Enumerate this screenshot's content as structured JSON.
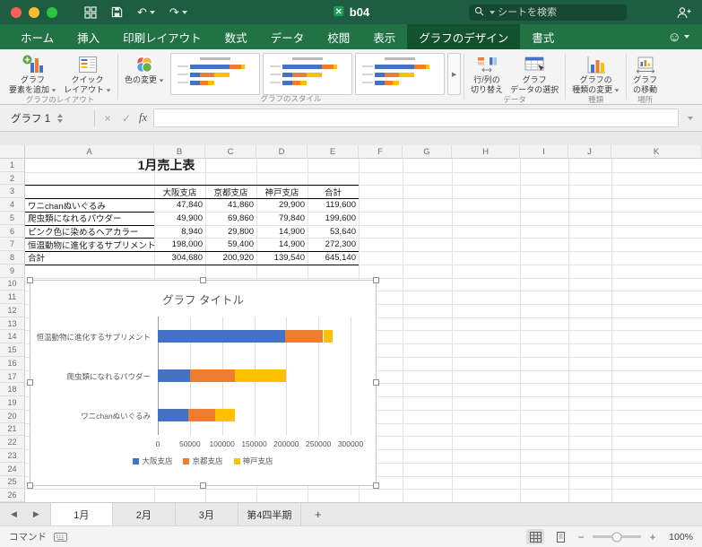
{
  "titlebar": {
    "title": "b04",
    "search_placeholder": "シートを検索"
  },
  "icons": {
    "undo": "↶",
    "redo": "↷",
    "smiley": "☺",
    "prev_sheet": "◀",
    "next_sheet": "▶",
    "gallery_more": "▶",
    "cancel": "×",
    "enter": "✓",
    "zoom_out": "−",
    "zoom_in": "+"
  },
  "ribbon_tabs": {
    "tabs": [
      "ホーム",
      "挿入",
      "印刷レイアウト",
      "数式",
      "データ",
      "校閲",
      "表示",
      "グラフのデザイン",
      "書式"
    ],
    "active": "グラフのデザイン"
  },
  "ribbon": {
    "add_chart_element": {
      "lines": [
        "グラフ",
        "要素を追加"
      ]
    },
    "quick_layout": {
      "lines": [
        "クイック",
        "レイアウト"
      ]
    },
    "change_colors": {
      "label": "色の変更"
    },
    "layout_group_label": "グラフのレイアウト",
    "styles_group_label": "グラフのスタイル",
    "switch_row_column": {
      "lines": [
        "行/列の",
        "切り替え"
      ]
    },
    "select_data": {
      "lines": [
        "グラフ",
        "データの選択"
      ]
    },
    "data_group_label": "データ",
    "change_chart_type": {
      "lines": [
        "グラフの",
        "種類の変更"
      ]
    },
    "type_group_label": "種類",
    "move_chart": {
      "lines": [
        "グラフ",
        "の移動"
      ]
    },
    "location_group_label": "場所",
    "style_thumbnail_count": 3
  },
  "formula_bar": {
    "name_box": "グラフ 1",
    "fx": "fx",
    "formula": ""
  },
  "sheet": {
    "columns": [
      "A",
      "B",
      "C",
      "D",
      "E",
      "F",
      "G",
      "H",
      "I",
      "J",
      "K"
    ],
    "row_count": 26,
    "table": {
      "title": "1月売上表",
      "column_headers": [
        "大阪支店",
        "京都支店",
        "神戸支店",
        "合計"
      ],
      "rows": [
        {
          "label": "ワニchanぬいぐるみ",
          "values": [
            "47,840",
            "41,860",
            "29,900",
            "119,600"
          ]
        },
        {
          "label": "爬虫類になれるパウダー",
          "values": [
            "49,900",
            "69,860",
            "79,840",
            "199,600"
          ]
        },
        {
          "label": "ピンク色に染めるヘアカラー",
          "values": [
            "8,940",
            "29,800",
            "14,900",
            "53,640"
          ]
        },
        {
          "label": "恒温動物に進化するサプリメント",
          "values": [
            "198,000",
            "59,400",
            "14,900",
            "272,300"
          ]
        }
      ],
      "total_row": {
        "label": "合計",
        "values": [
          "304,680",
          "200,920",
          "139,540",
          "645,140"
        ]
      }
    }
  },
  "chart_data": {
    "type": "bar",
    "orientation": "horizontal",
    "stacked": true,
    "title": "グラフ タイトル",
    "categories": [
      "恒温動物に進化するサプリメント",
      "爬虫類になれるパウダー",
      "ワニchanぬいぐるみ"
    ],
    "series": [
      {
        "name": "大阪支店",
        "color": "#4472c4",
        "values": [
          198000,
          49900,
          47840
        ]
      },
      {
        "name": "京都支店",
        "color": "#ed7d31",
        "values": [
          59400,
          69860,
          41860
        ]
      },
      {
        "name": "神戸支店",
        "color": "#ffc000",
        "values": [
          14900,
          79840,
          29900
        ]
      }
    ],
    "xlim": [
      0,
      300000
    ],
    "x_ticks": [
      0,
      50000,
      100000,
      150000,
      200000,
      250000,
      300000
    ],
    "x_tick_labels": [
      "0",
      "50000",
      "100000",
      "150000",
      "200000",
      "250000",
      "300000"
    ],
    "grid": true,
    "legend_position": "bottom"
  },
  "sheet_tabs": {
    "tabs": [
      "1月",
      "2月",
      "3月",
      "第4四半期"
    ],
    "active": "1月",
    "add_tab": "+"
  },
  "status_bar": {
    "mode": "コマンド",
    "zoom": "100%"
  }
}
